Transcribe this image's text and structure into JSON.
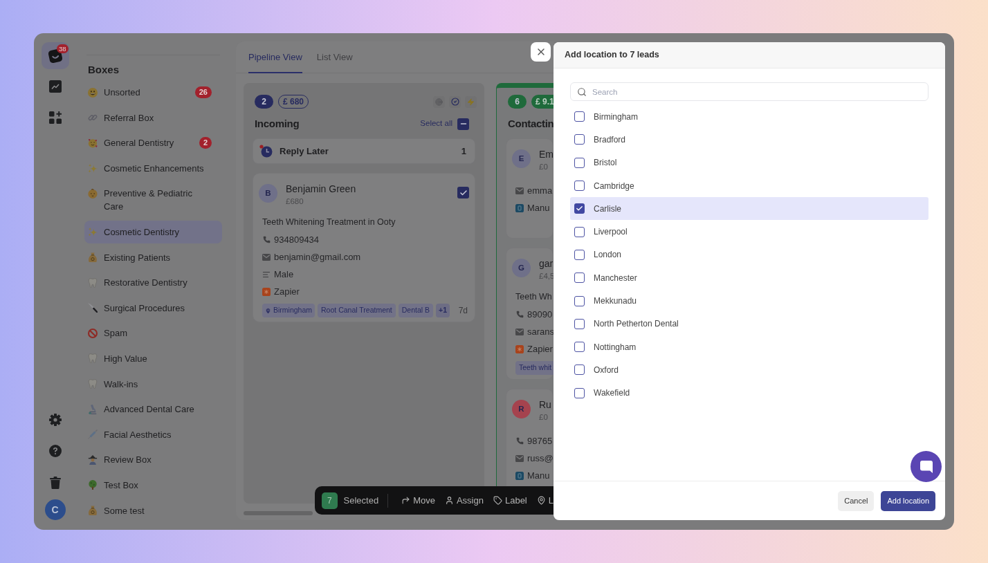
{
  "rail": {
    "notifications": "38",
    "avatar": "C"
  },
  "sidebar": {
    "title": "Boxes",
    "items": [
      {
        "label": "Unsorted",
        "kind": "grin",
        "count": "26",
        "selected": false
      },
      {
        "label": "Referral Box",
        "kind": "link",
        "selected": false
      },
      {
        "label": "General Dentistry",
        "kind": "love",
        "count": "2",
        "selected": false
      },
      {
        "label": "Cosmetic Enhancements",
        "kind": "sparkles",
        "selected": false
      },
      {
        "label": "Preventive & Pediatric Care",
        "kind": "baby",
        "selected": false
      },
      {
        "label": "Cosmetic Dentistry",
        "kind": "sparkles",
        "selected": true
      },
      {
        "label": "Existing Patients",
        "kind": "moneybag",
        "selected": false
      },
      {
        "label": "Restorative Dentistry",
        "kind": "tooth",
        "selected": false
      },
      {
        "label": "Surgical Procedures",
        "kind": "knife",
        "selected": false
      },
      {
        "label": "Spam",
        "kind": "prohibited",
        "selected": false
      },
      {
        "label": "High Value",
        "kind": "tooth",
        "selected": false
      },
      {
        "label": "Walk-ins",
        "kind": "tooth",
        "selected": false
      },
      {
        "label": "Advanced Dental Care",
        "kind": "microscope",
        "selected": false
      },
      {
        "label": "Facial Aesthetics",
        "kind": "syringe",
        "selected": false
      },
      {
        "label": "Review Box",
        "kind": "detective",
        "selected": false
      },
      {
        "label": "Test Box",
        "kind": "tree",
        "selected": false
      },
      {
        "label": "Some test",
        "kind": "moneybag",
        "selected": false
      }
    ]
  },
  "tabs": [
    {
      "label": "Pipeline View",
      "selected": true
    },
    {
      "label": "List View",
      "selected": false
    }
  ],
  "board": {
    "columns": [
      {
        "kind": "plain",
        "color": "#272b5f",
        "count": "2",
        "value": "£ 680",
        "title": "Incoming",
        "tools": [
          {
            "kind": "target"
          },
          {
            "kind": "check"
          },
          {
            "kind": "bolt"
          }
        ],
        "select_all": {
          "label": "Select all",
          "indeterminate": true
        },
        "groups": [
          {
            "label": "Reply Later",
            "count": "1"
          }
        ],
        "cards": [
          {
            "initial": "B",
            "color": "#6f7089",
            "name": "Benjamin Green",
            "value": "£680",
            "checked": true,
            "title": "Teeth Whitening Treatment in Ooty",
            "details": [
              {
                "kind": "phone",
                "text": "934809434"
              },
              {
                "kind": "email",
                "text": "benjamin@gmail.com"
              },
              {
                "kind": "gender",
                "text": "Male"
              },
              {
                "kind": "zapier",
                "text": "Zapier"
              }
            ],
            "tags": [
              {
                "kind": "location",
                "label": "Birmingham"
              },
              {
                "kind": "plain",
                "label": "Root Canal Treatment"
              },
              {
                "kind": "plain",
                "label": "Dental B"
              }
            ],
            "more": "+1",
            "age": "7d"
          }
        ]
      },
      {
        "kind": "highlighted",
        "color": "#1f6a3b",
        "count": "6",
        "value": "£ 9.1",
        "title": "Contactin",
        "cards": [
          {
            "initial": "E",
            "color": "#6f7089",
            "name": "Em",
            "value": "£0",
            "details": [
              {
                "kind": "email",
                "text": "emma"
              },
              {
                "kind": "manual",
                "text": "Manu"
              }
            ]
          },
          {
            "initial": "G",
            "color": "#6f7089",
            "name": "gar",
            "value": "£4,5",
            "title": "Teeth Wh",
            "details": [
              {
                "kind": "phone",
                "text": "89090"
              },
              {
                "kind": "email",
                "text": "sarans"
              },
              {
                "kind": "zapier",
                "text": "Zapier"
              }
            ],
            "tags": [
              {
                "kind": "plain",
                "label": "Teeth whit"
              }
            ]
          },
          {
            "initial": "R",
            "color": "#a5434e",
            "name": "Ru",
            "value": "£0",
            "details": [
              {
                "kind": "phone",
                "text": "98765"
              },
              {
                "kind": "email",
                "text": "russ@"
              },
              {
                "kind": "manual",
                "text": "Manu"
              }
            ]
          }
        ]
      }
    ]
  },
  "bulk_bar": {
    "count": "7",
    "label": "Selected",
    "actions": [
      {
        "kind": "move",
        "label": "Move"
      },
      {
        "kind": "assign",
        "label": "Assign"
      },
      {
        "kind": "label",
        "label": "Label"
      },
      {
        "kind": "location",
        "label": "L"
      }
    ]
  },
  "modal": {
    "title": "Add location to 7 leads",
    "search": {
      "placeholder": "Search"
    },
    "options": [
      {
        "label": "Birmingham",
        "checked": false
      },
      {
        "label": "Bradford",
        "checked": false
      },
      {
        "label": "Bristol",
        "checked": false
      },
      {
        "label": "Cambridge",
        "checked": false
      },
      {
        "label": "Carlisle",
        "checked": true
      },
      {
        "label": "Liverpool",
        "checked": false
      },
      {
        "label": "London",
        "checked": false
      },
      {
        "label": "Manchester",
        "checked": false
      },
      {
        "label": "Mekkunadu",
        "checked": false
      },
      {
        "label": "North Petherton Dental",
        "checked": false
      },
      {
        "label": "Nottingham",
        "checked": false
      },
      {
        "label": "Oxford",
        "checked": false
      },
      {
        "label": "Wakefield",
        "checked": false
      }
    ],
    "buttons": [
      {
        "kind": "secondary",
        "label": "Cancel"
      },
      {
        "kind": "primary",
        "label": "Add location"
      }
    ]
  }
}
